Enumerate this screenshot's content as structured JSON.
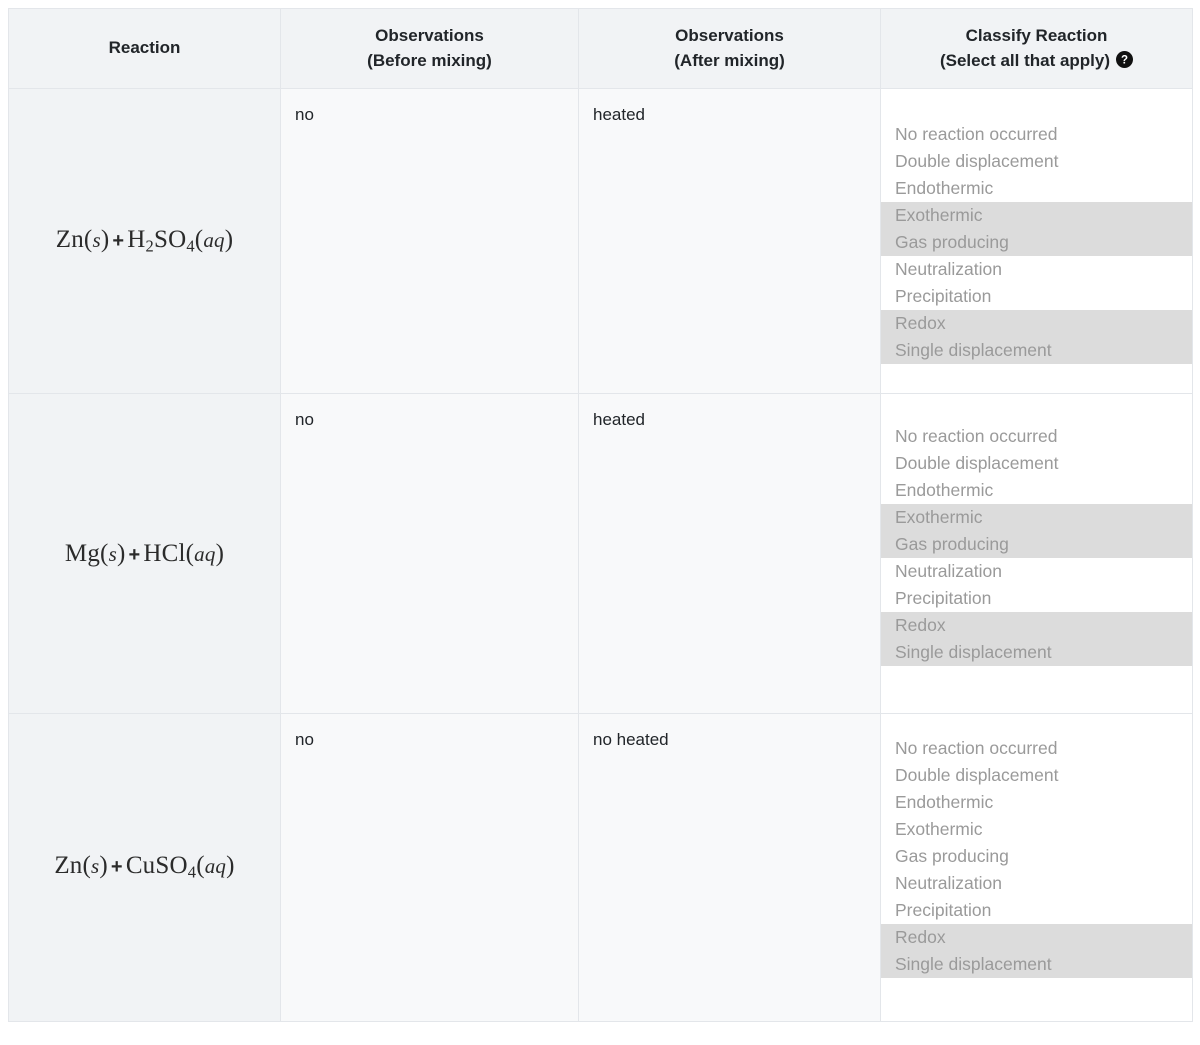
{
  "table": {
    "headers": [
      {
        "line1": "Reaction",
        "line2": ""
      },
      {
        "line1": "Observations",
        "line2": "(Before mixing)"
      },
      {
        "line1": "Observations",
        "line2": "(After mixing)"
      },
      {
        "line1": "Classify Reaction",
        "line2": "(Select all that apply)",
        "icon": "help-circle-icon"
      }
    ],
    "classify_options": [
      "No reaction occurred",
      "Double displacement",
      "Endothermic",
      "Exothermic",
      "Gas producing",
      "Neutralization",
      "Precipitation",
      "Redox",
      "Single displacement"
    ],
    "rows": [
      {
        "reaction": {
          "parts": [
            {
              "t": "Zn",
              "k": "sym"
            },
            {
              "t": "(",
              "k": "paren"
            },
            {
              "t": "s",
              "k": "state"
            },
            {
              "t": ")",
              "k": "paren"
            },
            {
              "t": "+",
              "k": "plus"
            },
            {
              "t": "H",
              "k": "sym"
            },
            {
              "t": "2",
              "k": "sub"
            },
            {
              "t": "SO",
              "k": "sym"
            },
            {
              "t": "4",
              "k": "sub"
            },
            {
              "t": "(",
              "k": "paren"
            },
            {
              "t": "aq",
              "k": "state"
            },
            {
              "t": ")",
              "k": "paren"
            }
          ],
          "plain": "Zn(s) + H2SO4(aq)"
        },
        "before": "no",
        "after": "heated",
        "selected": [
          "Exothermic",
          "Gas producing",
          "Redox",
          "Single displacement"
        ]
      },
      {
        "reaction": {
          "parts": [
            {
              "t": "Mg",
              "k": "sym"
            },
            {
              "t": "(",
              "k": "paren"
            },
            {
              "t": "s",
              "k": "state"
            },
            {
              "t": ")",
              "k": "paren"
            },
            {
              "t": "+",
              "k": "plus"
            },
            {
              "t": "HCl",
              "k": "sym"
            },
            {
              "t": "(",
              "k": "paren"
            },
            {
              "t": "aq",
              "k": "state"
            },
            {
              "t": ")",
              "k": "paren"
            }
          ],
          "plain": "Mg(s) + HCl(aq)"
        },
        "before": "no",
        "after": "heated",
        "selected": [
          "Exothermic",
          "Gas producing",
          "Redox",
          "Single displacement"
        ]
      },
      {
        "reaction": {
          "parts": [
            {
              "t": "Zn",
              "k": "sym"
            },
            {
              "t": "(",
              "k": "paren"
            },
            {
              "t": "s",
              "k": "state"
            },
            {
              "t": ")",
              "k": "paren"
            },
            {
              "t": "+",
              "k": "plus"
            },
            {
              "t": "CuSO",
              "k": "sym"
            },
            {
              "t": "4",
              "k": "sub"
            },
            {
              "t": "(",
              "k": "paren"
            },
            {
              "t": "aq",
              "k": "state"
            },
            {
              "t": ")",
              "k": "paren"
            }
          ],
          "plain": "Zn(s) + CuSO4(aq)"
        },
        "before": "no",
        "after": "no heated",
        "selected": [
          "Redox",
          "Single displacement"
        ]
      }
    ]
  },
  "colors": {
    "header_bg": "#f1f3f5",
    "reaction_cell_bg": "#f1f3f5",
    "observation_cell_bg": "#f8f9fa",
    "classify_cell_bg": "#ffffff",
    "border": "#e3e6ea",
    "option_text": "#9a9a9a",
    "option_selected_bg": "#dcdcdc",
    "heading_text": "#212529"
  }
}
